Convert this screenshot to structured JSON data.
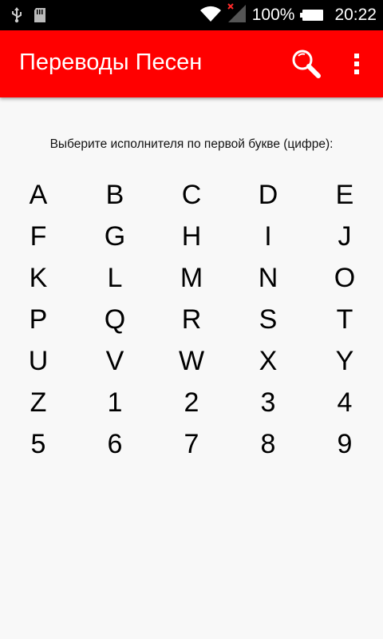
{
  "status_bar": {
    "icons_left": [
      "usb-icon",
      "sd-card-icon"
    ],
    "icons_right": [
      "wifi-icon",
      "signal-no-service-icon"
    ],
    "battery_text": "100%",
    "time": "20:22"
  },
  "app_bar": {
    "title": "Переводы Песен",
    "background": "#ff0000",
    "actions": [
      "search-icon",
      "overflow-menu-icon"
    ]
  },
  "main": {
    "prompt": "Выберите исполнителя по первой букве (цифре):",
    "keys": [
      "A",
      "B",
      "C",
      "D",
      "E",
      "F",
      "G",
      "H",
      "I",
      "J",
      "K",
      "L",
      "M",
      "N",
      "O",
      "P",
      "Q",
      "R",
      "S",
      "T",
      "U",
      "V",
      "W",
      "X",
      "Y",
      "Z",
      "1",
      "2",
      "3",
      "4",
      "5",
      "6",
      "7",
      "8",
      "9"
    ]
  }
}
